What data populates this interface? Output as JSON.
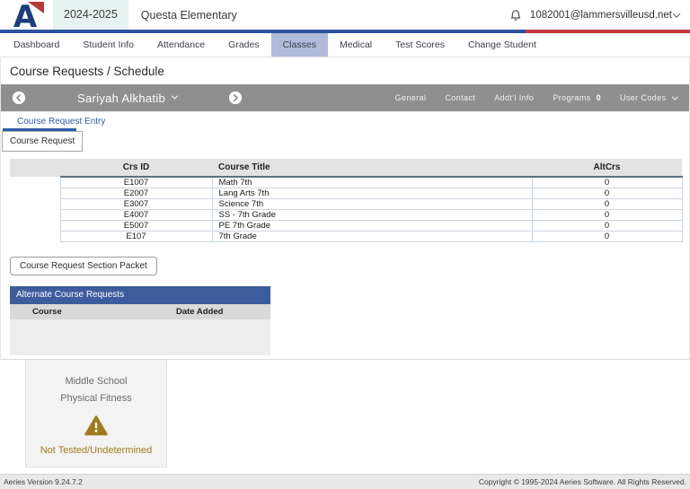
{
  "header": {
    "year": "2024-2025",
    "school": "Questa Elementary",
    "account": "1082001@lammersvilleusd.net"
  },
  "nav": {
    "items": [
      {
        "label": "Dashboard",
        "active": false
      },
      {
        "label": "Student Info",
        "active": false
      },
      {
        "label": "Attendance",
        "active": false
      },
      {
        "label": "Grades",
        "active": false
      },
      {
        "label": "Classes",
        "active": true
      },
      {
        "label": "Medical",
        "active": false
      },
      {
        "label": "Test Scores",
        "active": false
      },
      {
        "label": "Change Student",
        "active": false
      }
    ]
  },
  "page": {
    "title": "Course Requests / Schedule"
  },
  "student_bar": {
    "name": "Sariyah Alkhatib",
    "link_general": "General",
    "link_contact": "Contact",
    "link_addtl": "Addt'l Info",
    "programs_label": "Programs",
    "programs_count": "0",
    "user_codes_label": "User Codes"
  },
  "subtab": {
    "label": "Course Request Entry"
  },
  "tab": {
    "label": "Course Request"
  },
  "course_table": {
    "headers": {
      "crs_id": "Crs ID",
      "title": "Course Title",
      "altcrs": "AltCrs"
    },
    "rows": [
      {
        "crs_id": "E1007",
        "title": "Math 7th",
        "altcrs": "0"
      },
      {
        "crs_id": "E2007",
        "title": "Lang Arts 7th",
        "altcrs": "0"
      },
      {
        "crs_id": "E3007",
        "title": "Science 7th",
        "altcrs": "0"
      },
      {
        "crs_id": "E4007",
        "title": "SS - 7th Grade",
        "altcrs": "0"
      },
      {
        "crs_id": "E5007",
        "title": "PE 7th Grade",
        "altcrs": "0"
      },
      {
        "crs_id": "E107",
        "title": "7th Grade",
        "altcrs": "0"
      }
    ]
  },
  "buttons": {
    "section_packet": "Course Request Section Packet"
  },
  "alternate": {
    "title": "Alternate Course Requests",
    "header_course": "Course",
    "header_date": "Date Added"
  },
  "fitness": {
    "line1": "Middle School",
    "line2": "Physical Fitness",
    "status": "Not Tested/Undetermined"
  },
  "footer": {
    "version": "Aeries Version 9.24.7.2",
    "copyright": "Copyright © 1995-2024 Aeries Software. All Rights Reserved."
  },
  "colors": {
    "brand_navy": "#1c3c7c",
    "brand_red": "#b5393b",
    "divider_blue": "#2a52a0",
    "divider_red": "#c03a40",
    "year_bg": "#e7f3f0",
    "nav_active_bg": "#afbbd9",
    "student_bar_bg": "#8f8f8f",
    "link_blue": "#2d5ca8",
    "table_header_bg": "#e3e3e3",
    "table_header_underline": "#5c7080",
    "row_border": "#ccd5de",
    "alt_header_blue": "#3d5c9e",
    "warning_gold": "#a17c1f",
    "footer_bg": "#e9e9e9"
  }
}
